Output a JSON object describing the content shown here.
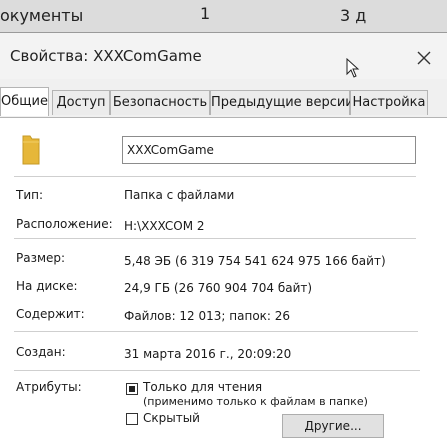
{
  "background": {
    "texts": [
      "окументы",
      "1",
      "3 д"
    ]
  },
  "dialog": {
    "title": "Свойства: XXXComGame",
    "tabs": [
      "Общие",
      "Доступ",
      "Безопасность",
      "Предыдущие версии",
      "Настройка"
    ],
    "active_tab": 0,
    "folder_name": "XXXComGame",
    "properties": {
      "type_label": "Тип:",
      "type_value": "Папка с файлами",
      "location_label": "Расположение:",
      "location_value": "H:\\XXXCOM 2",
      "size_label": "Размер:",
      "size_value": "5,48 ЭБ (6 319 754 541 624 975 166 байт)",
      "disk_label": "На диске:",
      "disk_value": "24,9 ГБ (26 760 904 704 байт)",
      "contains_label": "Содержит:",
      "contains_value": "Файлов: 12 013; папок: 26",
      "created_label": "Создан:",
      "created_value": "31 марта 2016 г., 20:09:20"
    },
    "attributes": {
      "label": "Атрибуты:",
      "readonly_label": "Только для чтения",
      "readonly_note": "(применимо только к файлам в папке)",
      "hidden_label": "Скрытый",
      "other_button": "Другие..."
    },
    "icons": [
      "folder-icon",
      "close-icon",
      "mouse-cursor-icon"
    ],
    "colors": {
      "folder": "#e6b73a",
      "panel": "#ffffff",
      "window": "#f0f0f0"
    }
  }
}
